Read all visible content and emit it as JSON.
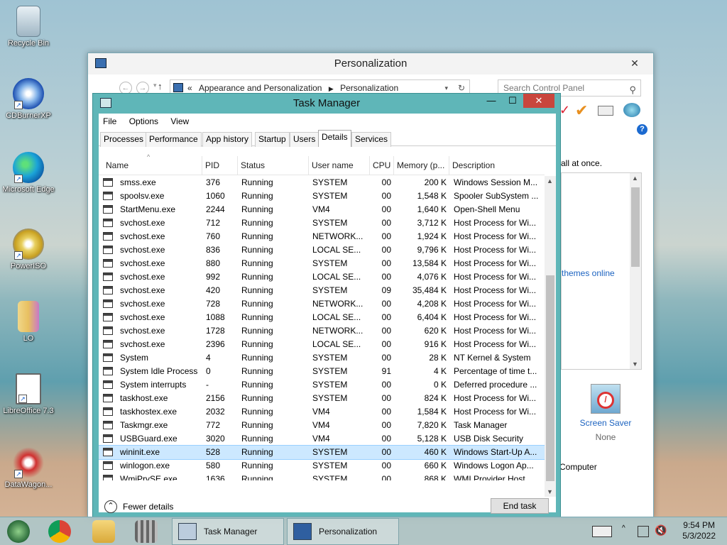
{
  "desktop": {
    "icons": [
      {
        "label": "Recycle Bin"
      },
      {
        "label": "CDBurnerXP"
      },
      {
        "label": "Microsoft Edge"
      },
      {
        "label": "PowerISO"
      },
      {
        "label": "LO"
      },
      {
        "label": "LibreOffice 7.3"
      },
      {
        "label": "DataWagon..."
      }
    ]
  },
  "personalization": {
    "title": "Personalization",
    "breadcrumb_prefix": "«",
    "breadcrumb": [
      "Appearance and Personalization",
      "Personalization"
    ],
    "search_placeholder": "Search Control Panel",
    "side_text_1": "all at once.",
    "side_link": "themes online",
    "screen_saver_label": "Screen Saver",
    "screen_saver_value": "None",
    "computer_label": "Computer"
  },
  "task_manager": {
    "title": "Task Manager",
    "menu": [
      "File",
      "Options",
      "View"
    ],
    "tabs": [
      "Processes",
      "Performance",
      "App history",
      "Startup",
      "Users",
      "Details",
      "Services"
    ],
    "active_tab": "Details",
    "columns": [
      "Name",
      "PID",
      "Status",
      "User name",
      "CPU",
      "Memory (p...",
      "Description"
    ],
    "rows": [
      [
        "smss.exe",
        "376",
        "Running",
        "SYSTEM",
        "00",
        "200 K",
        "Windows Session M..."
      ],
      [
        "spoolsv.exe",
        "1060",
        "Running",
        "SYSTEM",
        "00",
        "1,548 K",
        "Spooler SubSystem ..."
      ],
      [
        "StartMenu.exe",
        "2244",
        "Running",
        "VM4",
        "00",
        "1,640 K",
        "Open-Shell Menu"
      ],
      [
        "svchost.exe",
        "712",
        "Running",
        "SYSTEM",
        "00",
        "3,712 K",
        "Host Process for Wi..."
      ],
      [
        "svchost.exe",
        "760",
        "Running",
        "NETWORK...",
        "00",
        "1,924 K",
        "Host Process for Wi..."
      ],
      [
        "svchost.exe",
        "836",
        "Running",
        "LOCAL SE...",
        "00",
        "9,796 K",
        "Host Process for Wi..."
      ],
      [
        "svchost.exe",
        "880",
        "Running",
        "SYSTEM",
        "00",
        "13,584 K",
        "Host Process for Wi..."
      ],
      [
        "svchost.exe",
        "992",
        "Running",
        "LOCAL SE...",
        "00",
        "4,076 K",
        "Host Process for Wi..."
      ],
      [
        "svchost.exe",
        "420",
        "Running",
        "SYSTEM",
        "09",
        "35,484 K",
        "Host Process for Wi..."
      ],
      [
        "svchost.exe",
        "728",
        "Running",
        "NETWORK...",
        "00",
        "4,208 K",
        "Host Process for Wi..."
      ],
      [
        "svchost.exe",
        "1088",
        "Running",
        "LOCAL SE...",
        "00",
        "6,404 K",
        "Host Process for Wi..."
      ],
      [
        "svchost.exe",
        "1728",
        "Running",
        "NETWORK...",
        "00",
        "620 K",
        "Host Process for Wi..."
      ],
      [
        "svchost.exe",
        "2396",
        "Running",
        "LOCAL SE...",
        "00",
        "916 K",
        "Host Process for Wi..."
      ],
      [
        "System",
        "4",
        "Running",
        "SYSTEM",
        "00",
        "28 K",
        "NT Kernel & System"
      ],
      [
        "System Idle Process",
        "0",
        "Running",
        "SYSTEM",
        "91",
        "4 K",
        "Percentage of time t..."
      ],
      [
        "System interrupts",
        "-",
        "Running",
        "SYSTEM",
        "00",
        "0 K",
        "Deferred procedure ..."
      ],
      [
        "taskhost.exe",
        "2156",
        "Running",
        "SYSTEM",
        "00",
        "824 K",
        "Host Process for Wi..."
      ],
      [
        "taskhostex.exe",
        "2032",
        "Running",
        "VM4",
        "00",
        "1,584 K",
        "Host Process for Wi..."
      ],
      [
        "Taskmgr.exe",
        "772",
        "Running",
        "VM4",
        "00",
        "7,820 K",
        "Task Manager"
      ],
      [
        "USBGuard.exe",
        "3020",
        "Running",
        "VM4",
        "00",
        "5,128 K",
        "USB Disk Security"
      ],
      [
        "wininit.exe",
        "528",
        "Running",
        "SYSTEM",
        "00",
        "460 K",
        "Windows Start-Up A..."
      ],
      [
        "winlogon.exe",
        "580",
        "Running",
        "SYSTEM",
        "00",
        "660 K",
        "Windows Logon Ap..."
      ],
      [
        "WmiPrvSE.exe",
        "1636",
        "Running",
        "SYSTEM",
        "00",
        "868 K",
        "WMI Provider Host"
      ]
    ],
    "selected_row": 20,
    "fewer_details": "Fewer details",
    "end_task": "End task"
  },
  "taskbar": {
    "buttons": [
      "Task Manager",
      "Personalization"
    ],
    "time": "9:54 PM",
    "date": "5/3/2022"
  }
}
